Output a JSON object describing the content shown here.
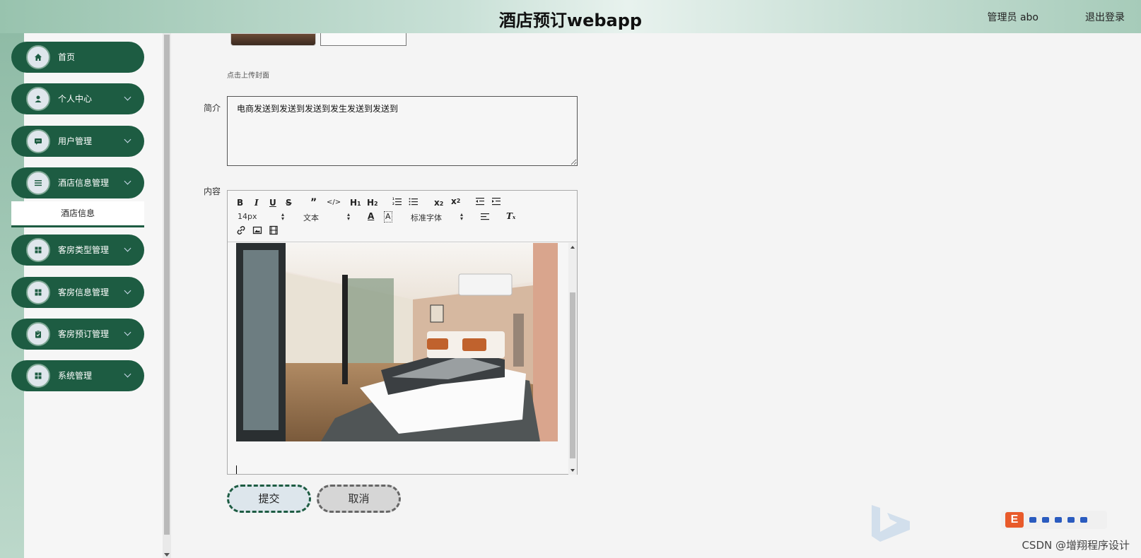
{
  "header": {
    "title": "酒店预订webapp",
    "admin_label": "管理员 abo",
    "logout_label": "退出登录"
  },
  "sidebar": {
    "items": [
      {
        "label": "首页",
        "icon": "home-icon",
        "has_chevron": false
      },
      {
        "label": "个人中心",
        "icon": "user-icon",
        "has_chevron": true
      },
      {
        "label": "用户管理",
        "icon": "chat-icon",
        "has_chevron": true
      },
      {
        "label": "酒店信息管理",
        "icon": "list-icon",
        "has_chevron": true
      },
      {
        "label": "客房类型管理",
        "icon": "grid-icon",
        "has_chevron": true
      },
      {
        "label": "客房信息管理",
        "icon": "grid-icon",
        "has_chevron": true
      },
      {
        "label": "客房预订管理",
        "icon": "clipboard-icon",
        "has_chevron": true
      },
      {
        "label": "系统管理",
        "icon": "grid-icon",
        "has_chevron": true
      }
    ],
    "active_submenu": "酒店信息"
  },
  "form": {
    "upload_hint": "点击上传封面",
    "intro_label": "简介",
    "intro_value": "电商发送到发送到发送到发生发送到发送到",
    "content_label": "内容",
    "submit_label": "提交",
    "cancel_label": "取消"
  },
  "editor": {
    "font_size": "14px",
    "block_format": "文本",
    "font_family": "标准字体",
    "image_alt": "hotel-room-photo"
  },
  "colors": {
    "brand": "#1d5c42",
    "header_gradient_mid": "#e8f2ee"
  },
  "watermark": "CSDN @增翔程序设计"
}
